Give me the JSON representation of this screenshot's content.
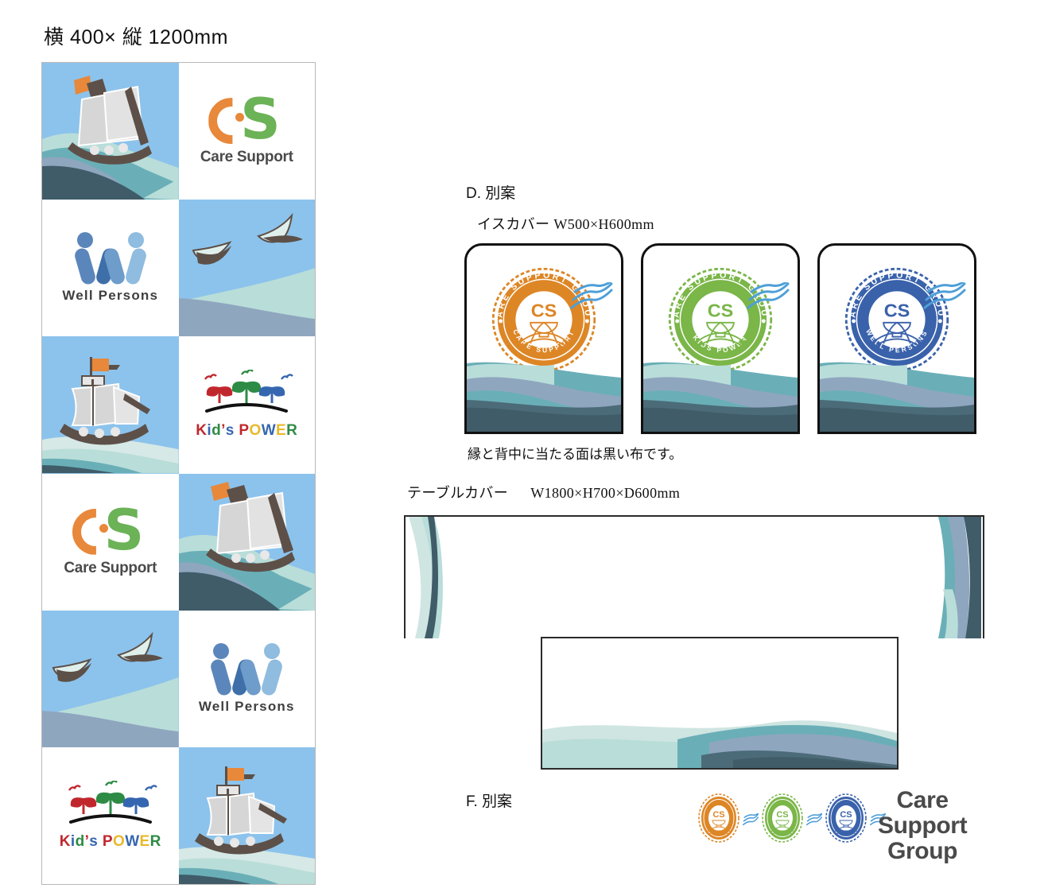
{
  "document": {
    "banner_size_label": "横 400× 縦 1200mm",
    "section_d": "D. 別案",
    "chair_cover_label": "イスカバー W500×H600mm",
    "chair_note": "縁と背中に当たる面は黒い布です。",
    "table_cover_label_name": "テーブルカバー",
    "table_cover_label_size": "W1800×H700×D600mm",
    "section_f": "F. 別案"
  },
  "brands": {
    "care_support": {
      "name": "Care Support",
      "color_c": "#e8883a",
      "color_s": "#6cb257"
    },
    "well_persons": {
      "name": "Well Persons",
      "color_dark": "#3f6fa8",
      "color_mid": "#5b86bb",
      "color_light": "#8fbcdf"
    },
    "kids_power": {
      "name": "Kid's POWER",
      "letters": [
        {
          "char": "K",
          "color": "#c0272d"
        },
        {
          "char": "i",
          "color": "#3566b0"
        },
        {
          "char": "d",
          "color": "#2e8b45"
        },
        {
          "char": "’",
          "color": "#c0272d"
        },
        {
          "char": "s",
          "color": "#3566b0"
        },
        {
          "char": " ",
          "color": "#ffffff"
        },
        {
          "char": "P",
          "color": "#c0272d"
        },
        {
          "char": "O",
          "color": "#e8b92b"
        },
        {
          "char": "W",
          "color": "#3566b0"
        },
        {
          "char": "E",
          "color": "#e8b92b"
        },
        {
          "char": "R",
          "color": "#2e8b45"
        }
      ]
    }
  },
  "banner": {
    "cells": [
      {
        "kind": "ship",
        "index": 0
      },
      {
        "kind": "logo",
        "brand": "care_support"
      },
      {
        "kind": "logo",
        "brand": "well_persons"
      },
      {
        "kind": "birds",
        "index": 1
      },
      {
        "kind": "ship",
        "index": 2
      },
      {
        "kind": "logo",
        "brand": "kids_power"
      },
      {
        "kind": "logo",
        "brand": "care_support"
      },
      {
        "kind": "ship",
        "index": 3
      },
      {
        "kind": "birds",
        "index": 4
      },
      {
        "kind": "logo",
        "brand": "well_persons"
      },
      {
        "kind": "logo",
        "brand": "kids_power"
      },
      {
        "kind": "ship",
        "index": 5
      }
    ]
  },
  "seals": {
    "arc_top_text": "CARE SUPPORT GROUP",
    "monogram": "CS",
    "variants": [
      {
        "id": "care-support",
        "bottom_text": "CARE SUPPORT",
        "color": "#dd8626"
      },
      {
        "id": "kids-power",
        "bottom_text": "KIDS POWER",
        "color": "#7ab648"
      },
      {
        "id": "well-persons",
        "bottom_text": "WELL PERSONS",
        "color": "#3a62ab"
      }
    ],
    "steam_color": "#4e9fd8"
  },
  "chair_covers": [
    {
      "seal": "care-support"
    },
    {
      "seal": "kids-power"
    },
    {
      "seal": "well-persons"
    }
  ],
  "table_cover": {
    "wordmark_line1": "Care Support",
    "wordmark_line2": "Group",
    "seals": [
      "care-support",
      "kids-power",
      "well-persons"
    ]
  },
  "palette": {
    "sky": "#8cc3ec",
    "wave_pale": "#d6e9e6",
    "wave_mint": "#b9ddd9",
    "wave_teal": "#6aafb7",
    "wave_steel": "#8fa6bf",
    "wave_deep": "#3f5c68",
    "wave_slate": "#4c6b79",
    "ship_hull": "#5d5048",
    "ship_sail": "#d6d6d6",
    "flag": "#e8883a"
  }
}
